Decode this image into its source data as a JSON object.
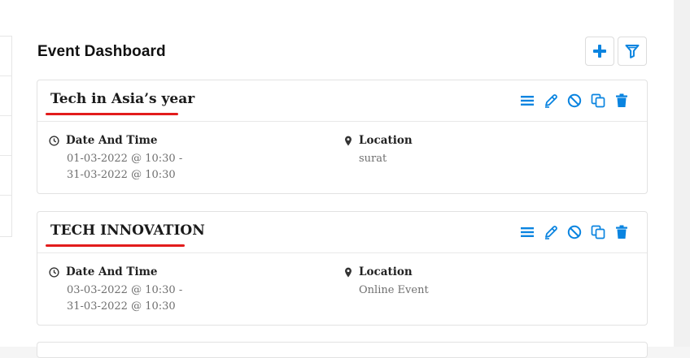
{
  "header": {
    "title": "Event Dashboard"
  },
  "colors": {
    "accent": "#0a84e0",
    "underline": "#e21c1c"
  },
  "events": [
    {
      "title": "Tech in Asia’s year",
      "date_label": "Date And Time",
      "date_start": "01-03-2022 @ 10:30 -",
      "date_end": "31-03-2022 @ 10:30",
      "location_label": "Location",
      "location": "surat"
    },
    {
      "title": "TECH INNOVATION",
      "date_label": "Date And Time",
      "date_start": "03-03-2022 @ 10:30 -",
      "date_end": "31-03-2022 @ 10:30",
      "location_label": "Location",
      "location": "Online Event"
    }
  ],
  "icons": {
    "add": "plus-icon",
    "filter": "filter-icon",
    "actions": [
      "list-icon",
      "edit-icon",
      "cancel-icon",
      "copy-icon",
      "delete-icon"
    ],
    "clock": "clock-icon",
    "location": "location-pin-icon"
  }
}
